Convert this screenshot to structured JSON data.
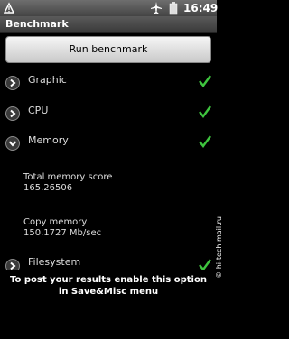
{
  "status_bar": {
    "time": "16:49",
    "icons": [
      "notification-icon",
      "airplane-icon",
      "battery-icon"
    ]
  },
  "title_bar": {
    "title": "Benchmark"
  },
  "run_button": {
    "label": "Run benchmark"
  },
  "rows": [
    {
      "label": "Graphic",
      "checked": true
    },
    {
      "label": "CPU",
      "checked": true
    },
    {
      "label": "Memory",
      "checked": true,
      "expanded": true
    },
    {
      "label": "Filesystem",
      "checked": true
    }
  ],
  "memory_details": {
    "total_label": "Total memory score",
    "total_value": "165.26506",
    "copy_label": "Copy memory",
    "copy_value": "150.1727 Mb/sec"
  },
  "footer": {
    "message": "To post your results enable this option in Save&Misc menu"
  },
  "watermark": {
    "text": "© hi-tech.mail.ru"
  },
  "colors": {
    "check": "#3ec43e",
    "background": "#000000"
  }
}
